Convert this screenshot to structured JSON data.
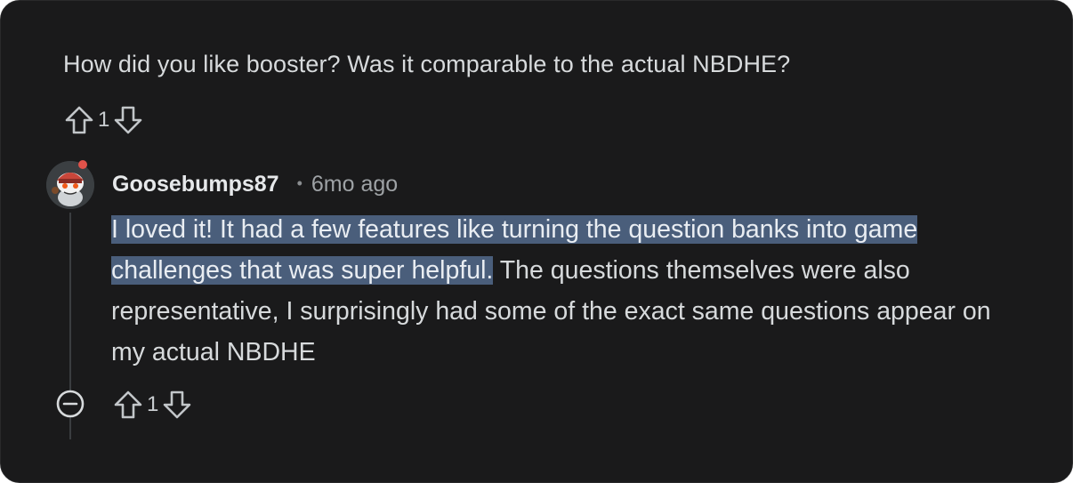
{
  "parent": {
    "text": "How did you like booster? Was it comparable to the actual NBDHE?",
    "vote_count": "1"
  },
  "reply": {
    "author": "Goosebumps87",
    "separator": "•",
    "time": "6mo ago",
    "text_highlighted": "I loved it! It had a few features like turning the question banks into game challenges that was super helpful.",
    "text_rest": " The questions themselves were also representative, I surprisingly had some of the exact same questions appear on my actual NBDHE",
    "vote_count": "1"
  },
  "icons": {
    "upvote": "arrow-up-outline-icon",
    "downvote": "arrow-down-outline-icon",
    "collapse": "minus-circle-icon",
    "avatar": "snoo-avatar"
  },
  "colors": {
    "background": "#1a1a1b",
    "text": "#d7dadc",
    "highlight": "#4a5e7b",
    "online_dot": "#e0524a"
  }
}
